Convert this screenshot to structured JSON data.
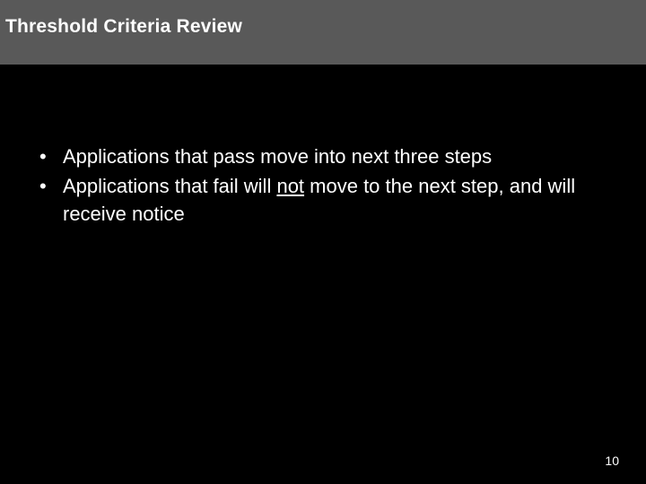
{
  "slide": {
    "title": "Threshold Criteria Review",
    "bullets": [
      {
        "pre": "Applications that pass move into next three steps",
        "u": "",
        "post": ""
      },
      {
        "pre": "Applications that fail will ",
        "u": "not",
        "post": " move to the next step, and will receive notice"
      }
    ],
    "page_number": "10"
  }
}
